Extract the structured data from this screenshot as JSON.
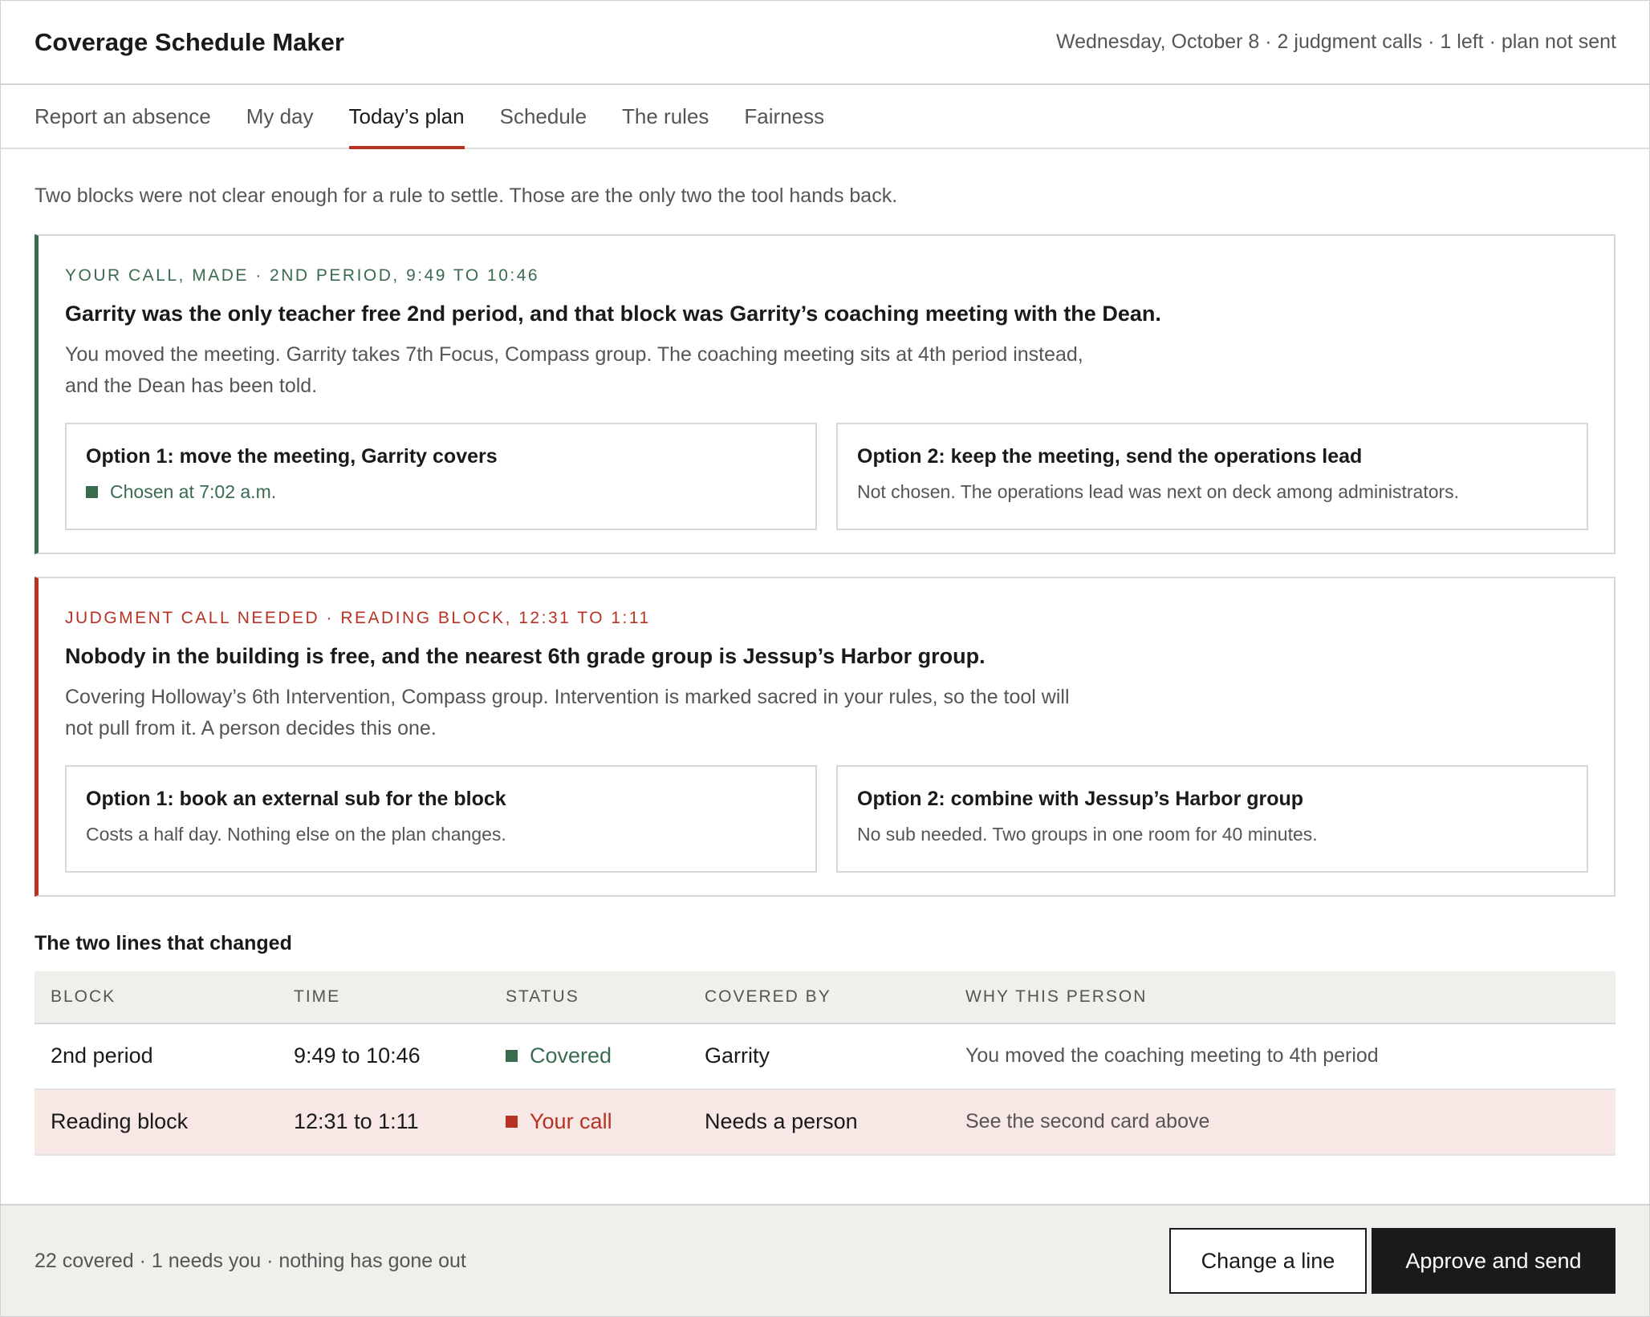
{
  "header": {
    "title": "Coverage Schedule Maker",
    "status": "Wednesday, October 8 · 2 judgment calls · 1 left · plan not sent"
  },
  "tabs": [
    {
      "label": "Report an absence",
      "active": false
    },
    {
      "label": "My day",
      "active": false
    },
    {
      "label": "Today’s plan",
      "active": true
    },
    {
      "label": "Schedule",
      "active": false
    },
    {
      "label": "The rules",
      "active": false
    },
    {
      "label": "Fairness",
      "active": false
    }
  ],
  "intro": "Two blocks were not clear enough for a rule to settle. Those are the only two the tool hands back.",
  "cards": [
    {
      "eyebrow": "Your call, made · 2nd period, 9:49 to 10:46",
      "headline": "Garrity was the only teacher free 2nd period, and that block was Garrity’s coaching meeting with the Dean.",
      "body": "You moved the meeting. Garrity takes 7th Focus, Compass group. The coaching meeting sits at 4th period instead, and the Dean has been told.",
      "options": [
        {
          "title": "Option 1: move the meeting, Garrity covers",
          "note": "Chosen at 7:02 a.m."
        },
        {
          "title": "Option 2: keep the meeting, send the operations lead",
          "note": "Not chosen. The operations lead was next on deck among administrators."
        }
      ]
    },
    {
      "eyebrow": "Judgment call needed · Reading block, 12:31 to 1:11",
      "headline": "Nobody in the building is free, and the nearest 6th grade group is Jessup’s Harbor group.",
      "body": "Covering Holloway’s 6th Intervention, Compass group. Intervention is marked sacred in your rules, so the tool will not pull from it. A person decides this one.",
      "options": [
        {
          "title": "Option 1: book an external sub for the block",
          "note": "Costs a half day. Nothing else on the plan changes."
        },
        {
          "title": "Option 2: combine with Jessup’s Harbor group",
          "note": "No sub needed. Two groups in one room for 40 minutes."
        }
      ]
    }
  ],
  "changes": {
    "title": "The two lines that changed",
    "columns": [
      "BLOCK",
      "TIME",
      "STATUS",
      "COVERED BY",
      "WHY THIS PERSON"
    ],
    "rows": [
      {
        "block": "2nd period",
        "time": "9:49 to 10:46",
        "status": "Covered",
        "covered_by": "Garrity",
        "why": "You moved the coaching meeting to 4th period"
      },
      {
        "block": "Reading block",
        "time": "12:31 to 1:11",
        "status": "Your call",
        "covered_by": "Needs a person",
        "why": "See the second card above"
      }
    ]
  },
  "footer": {
    "summary": "22 covered · 1 needs you · nothing has gone out",
    "change_label": "Change a line",
    "approve_label": "Approve and send"
  },
  "colors": {
    "accent_red": "#b83224",
    "accent_green": "#3a6b4f"
  }
}
